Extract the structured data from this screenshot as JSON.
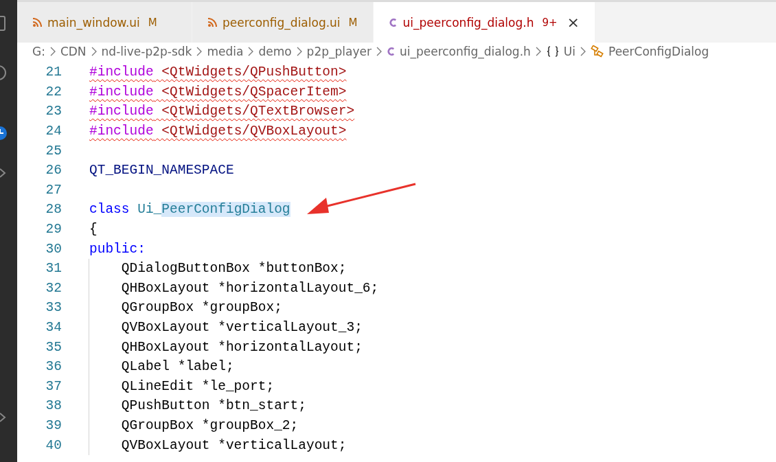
{
  "tabs": [
    {
      "kind": "rss",
      "label": "main_window.ui",
      "badge": "M",
      "color": "#9c5d00",
      "selected": false
    },
    {
      "kind": "rss",
      "label": "peerconfig_dialog.ui",
      "badge": "M",
      "color": "#9c5d00",
      "selected": false
    },
    {
      "kind": "c",
      "label": "ui_peerconfig_dialog.h",
      "badge": "9+",
      "color": "#b00000",
      "selected": true,
      "close": "×"
    }
  ],
  "breadcrumb": [
    {
      "kind": "folder",
      "label": "G:"
    },
    {
      "kind": "folder",
      "label": "CDN"
    },
    {
      "kind": "folder",
      "label": "nd-live-p2p-sdk"
    },
    {
      "kind": "folder",
      "label": "media"
    },
    {
      "kind": "folder",
      "label": "demo"
    },
    {
      "kind": "folder",
      "label": "p2p_player"
    },
    {
      "kind": "c",
      "label": "ui_peerconfig_dialog.h"
    },
    {
      "kind": "namespace",
      "label": "Ui"
    },
    {
      "kind": "class",
      "label": "PeerConfigDialog"
    }
  ],
  "editor": {
    "lines": [
      {
        "number": "21",
        "error": true,
        "tokens": [
          {
            "kind": "directive",
            "text": "#include"
          },
          {
            "kind": "string",
            "text": " <QtWidgets/QPushButton>"
          }
        ]
      },
      {
        "number": "22",
        "error": true,
        "tokens": [
          {
            "kind": "directive",
            "text": "#include"
          },
          {
            "kind": "string",
            "text": " <QtWidgets/QSpacerItem>"
          }
        ]
      },
      {
        "number": "23",
        "error": true,
        "tokens": [
          {
            "kind": "directive",
            "text": "#include"
          },
          {
            "kind": "string",
            "text": " <QtWidgets/QTextBrowser>"
          }
        ]
      },
      {
        "number": "24",
        "error": true,
        "tokens": [
          {
            "kind": "directive",
            "text": "#include"
          },
          {
            "kind": "string",
            "text": " <QtWidgets/QVBoxLayout>"
          }
        ]
      },
      {
        "number": "25"
      },
      {
        "number": "26",
        "error": false,
        "tokens": [
          {
            "kind": "macro",
            "text": "QT_BEGIN_NAMESPACE"
          }
        ]
      },
      {
        "number": "27"
      },
      {
        "number": "28",
        "error": false,
        "tokens": [
          {
            "kind": "keyword",
            "text": "class "
          },
          {
            "kind": "type",
            "text": "Ui_",
            "highlight": false
          },
          {
            "kind": "type",
            "text": "PeerConfigDialog",
            "highlight": true
          }
        ]
      },
      {
        "number": "29",
        "error": false,
        "tokens": [
          {
            "kind": "plain",
            "text": "{"
          }
        ]
      },
      {
        "number": "30",
        "error": false,
        "tokens": [
          {
            "kind": "keyword",
            "text": "public:"
          }
        ],
        "children": [
          {
            "number": "31",
            "error": false,
            "tokens": [
              {
                "kind": "plain",
                "text": "QDialogButtonBox *buttonBox;"
              }
            ]
          },
          {
            "number": "32",
            "error": false,
            "tokens": [
              {
                "kind": "plain",
                "text": "QHBoxLayout *horizontalLayout_6;"
              }
            ]
          },
          {
            "number": "33",
            "error": false,
            "tokens": [
              {
                "kind": "plain",
                "text": "QGroupBox *groupBox;"
              }
            ]
          },
          {
            "number": "34",
            "error": false,
            "tokens": [
              {
                "kind": "plain",
                "text": "QVBoxLayout *verticalLayout_3;"
              }
            ]
          },
          {
            "number": "35",
            "error": false,
            "tokens": [
              {
                "kind": "plain",
                "text": "QHBoxLayout *horizontalLayout;"
              }
            ]
          },
          {
            "number": "36",
            "error": false,
            "tokens": [
              {
                "kind": "plain",
                "text": "QLabel *label;"
              }
            ]
          },
          {
            "number": "37",
            "error": false,
            "tokens": [
              {
                "kind": "plain",
                "text": "QLineEdit *le_port;"
              }
            ]
          },
          {
            "number": "38",
            "error": false,
            "tokens": [
              {
                "kind": "plain",
                "text": "QPushButton *btn_start;"
              }
            ]
          },
          {
            "number": "39",
            "error": false,
            "tokens": [
              {
                "kind": "plain",
                "text": "QGroupBox *groupBox_2;"
              }
            ]
          },
          {
            "number": "40",
            "error": false,
            "tokens": [
              {
                "kind": "plain",
                "text": "QVBoxLayout *verticalLayout;"
              }
            ]
          }
        ]
      }
    ]
  }
}
